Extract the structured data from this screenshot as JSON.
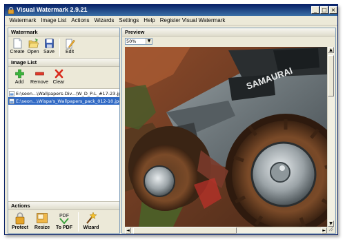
{
  "app": {
    "title": "Visual Watermark 2.9.21",
    "window_buttons": {
      "minimize": "_",
      "maximize": "□",
      "close": "×"
    }
  },
  "menu": [
    "Watermark",
    "Image List",
    "Actions",
    "Wizards",
    "Settings",
    "Help",
    "Register Visual Watermark"
  ],
  "watermark_section": {
    "title": "Watermark",
    "buttons": [
      {
        "label": "Create",
        "icon": "new-file-icon"
      },
      {
        "label": "Open",
        "icon": "open-folder-icon"
      },
      {
        "label": "Save",
        "icon": "floppy-disk-icon"
      },
      {
        "label": "Edit",
        "icon": "edit-pencil-icon"
      }
    ]
  },
  "image_list_section": {
    "title": "Image List",
    "buttons": [
      {
        "label": "Add",
        "icon": "plus-icon"
      },
      {
        "label": "Remove",
        "icon": "minus-icon"
      },
      {
        "label": "Clear",
        "icon": "x-icon"
      }
    ],
    "items": [
      {
        "path": "E:\\seon...\\Wallpapers-Div...\\W_D_P-L_#17-23.jpg",
        "selected": false
      },
      {
        "path": "E:\\seon...\\Wispa's_Wallpapers_pack_012-10.jpg",
        "selected": true
      }
    ]
  },
  "actions_section": {
    "title": "Actions",
    "buttons": [
      {
        "label": "Protect",
        "icon": "lock-icon"
      },
      {
        "label": "Resize",
        "icon": "resize-icon"
      },
      {
        "label": "To PDF",
        "icon": "pdf-icon",
        "icon_text": "PDF"
      },
      {
        "label": "Wizard",
        "icon": "wizard-icon"
      }
    ]
  },
  "preview": {
    "title": "Preview",
    "zoom": "50%",
    "zoom_arrow": "▼",
    "image_caption": "SAMAURAI",
    "scroll_arrows": {
      "up": "▲",
      "down": "▼",
      "left": "◄",
      "right": "►"
    }
  }
}
